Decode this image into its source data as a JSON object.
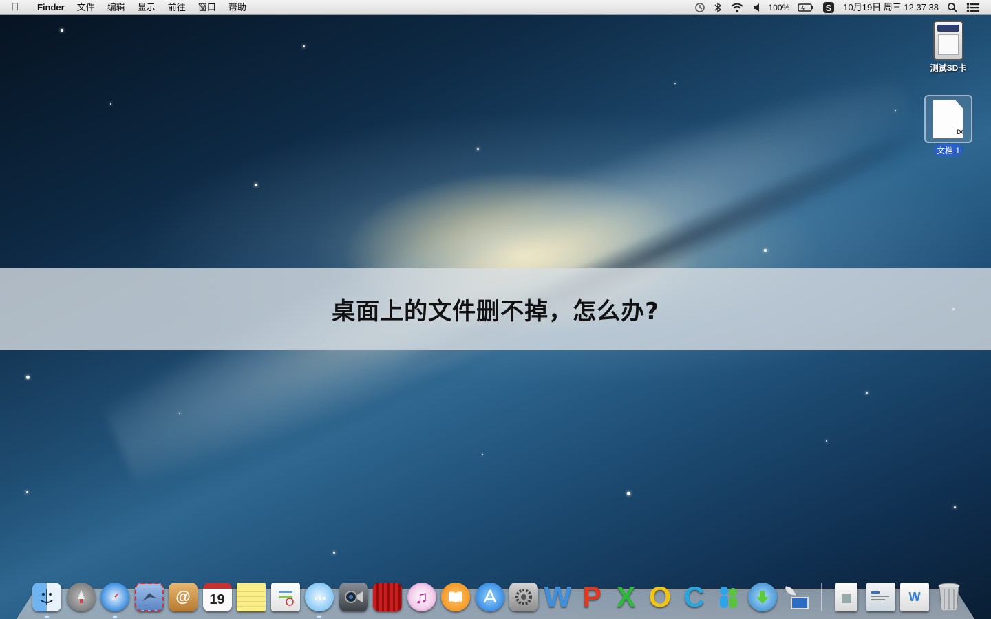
{
  "menubar": {
    "apple_icon": "apple-icon",
    "app_name": "Finder",
    "menus": [
      "文件",
      "编辑",
      "显示",
      "前往",
      "窗口",
      "帮助"
    ],
    "status": {
      "time_machine_icon": "time-machine-icon",
      "bluetooth_icon": "bluetooth-icon",
      "wifi_icon": "wifi-icon",
      "volume_icon": "volume-icon",
      "battery_percent": "100%",
      "battery_icon": "battery-icon",
      "sync_icon": "sync-icon",
      "datetime": "10月19日 周三  12 37 38",
      "search_icon": "spotlight-icon",
      "notification_icon": "notification-center-icon"
    }
  },
  "desktop": {
    "icons": [
      {
        "label": "测试SD卡",
        "icon": "sd-card-icon",
        "selected": false
      },
      {
        "label": "文档 1",
        "icon": "document-icon",
        "extension": "DOC",
        "selected": true
      }
    ]
  },
  "banner": {
    "title": "桌面上的文件删不掉，怎么办?"
  },
  "dock": {
    "apps": [
      {
        "name": "finder-icon"
      },
      {
        "name": "launchpad-icon"
      },
      {
        "name": "safari-icon"
      },
      {
        "name": "mail-icon"
      },
      {
        "name": "contacts-icon",
        "glyph": "@"
      },
      {
        "name": "calendar-icon",
        "glyph": "19"
      },
      {
        "name": "notes-icon"
      },
      {
        "name": "reminders-icon"
      },
      {
        "name": "messages-icon"
      },
      {
        "name": "facetime-icon"
      },
      {
        "name": "photo-booth-icon"
      },
      {
        "name": "itunes-icon",
        "glyph": "♫"
      },
      {
        "name": "ibooks-icon"
      },
      {
        "name": "app-store-icon"
      },
      {
        "name": "system-preferences-icon"
      },
      {
        "name": "word-icon",
        "glyph": "W"
      },
      {
        "name": "powerpoint-icon",
        "glyph": "P"
      },
      {
        "name": "excel-icon",
        "glyph": "X"
      },
      {
        "name": "outlook-icon",
        "glyph": "O"
      },
      {
        "name": "communicator-icon",
        "glyph": "C"
      },
      {
        "name": "messenger-icon"
      },
      {
        "name": "downloader-icon"
      },
      {
        "name": "remote-desktop-icon"
      }
    ],
    "docs": [
      {
        "name": "documents-stack-icon"
      },
      {
        "name": "screenshots-stack-icon"
      },
      {
        "name": "word-doc-stack-icon"
      },
      {
        "name": "trash-icon"
      }
    ]
  }
}
